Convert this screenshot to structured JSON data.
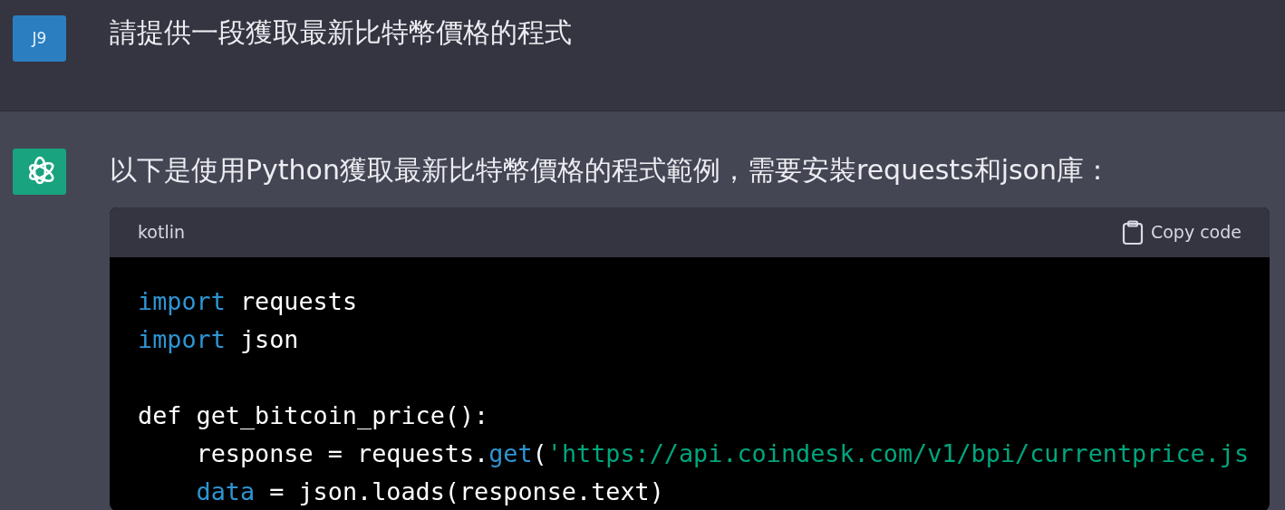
{
  "messages": [
    {
      "kind": "user",
      "avatar": "J9",
      "text": "請提供一段獲取最新比特幣價格的程式"
    },
    {
      "kind": "assistant",
      "text": "以下是使用Python獲取最新比特幣價格的程式範例，需要安裝requests和json庫：",
      "code_block": {
        "language": "kotlin",
        "copy_label": "Copy code",
        "lines": [
          {
            "kind": "code",
            "indented": false,
            "tokens": [
              {
                "kind": "keyword",
                "text": "import"
              },
              {
                "kind": "plain",
                "text": " requests"
              }
            ]
          },
          {
            "kind": "code",
            "indented": false,
            "tokens": [
              {
                "kind": "keyword",
                "text": "import"
              },
              {
                "kind": "plain",
                "text": " json"
              }
            ]
          },
          {
            "kind": "blank"
          },
          {
            "kind": "code",
            "indented": false,
            "tokens": [
              {
                "kind": "plain",
                "text": "def get_bitcoin_price():"
              }
            ]
          },
          {
            "kind": "code",
            "indented": true,
            "tokens": [
              {
                "kind": "plain",
                "text": "response = requests."
              },
              {
                "kind": "keyword",
                "text": "get"
              },
              {
                "kind": "plain",
                "text": "("
              },
              {
                "kind": "string",
                "text": "'https://api.coindesk.com/v1/bpi/currentprice.js"
              }
            ]
          },
          {
            "kind": "code",
            "indented": true,
            "tokens": [
              {
                "kind": "keyword",
                "text": "data"
              },
              {
                "kind": "plain",
                "text": " = json.loads(response.text)"
              }
            ]
          }
        ]
      }
    }
  ]
}
